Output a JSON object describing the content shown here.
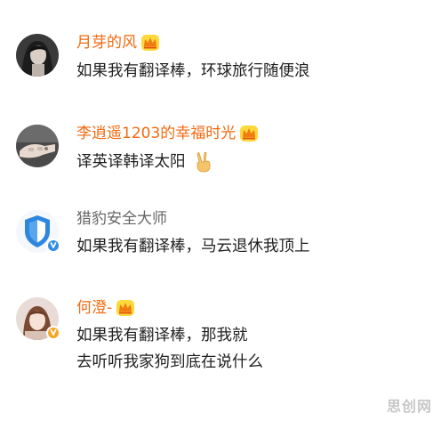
{
  "comments": [
    {
      "username": "月芽的风",
      "avatar": "avatar-photo-woman",
      "badge": "crown-icon",
      "lines": [
        "如果我有翻译棒，环球旅行随便浪"
      ]
    },
    {
      "username": "李逍遥1203的幸福时光",
      "avatar": "avatar-photo-hand",
      "badge": "crown-icon",
      "lines": [
        "译英译韩译太阳"
      ],
      "emoji": "victory-hand-emoji"
    },
    {
      "username": "猎豹安全大师",
      "avatar": "avatar-shield-logo",
      "verified": "blue-verified-icon",
      "lines": [
        "如果我有翻译棒，马云退休我顶上"
      ]
    },
    {
      "username": "何澄-",
      "avatar": "avatar-photo-girl",
      "badge": "crown-icon",
      "verified": "orange-verified-icon",
      "lines": [
        "如果我有翻译棒，那我就",
        "去听听我家狗到底在说什么"
      ]
    }
  ],
  "watermark": "思创网",
  "colors": {
    "vip_name": "#f26a10",
    "normal_name": "#666666",
    "text": "#1f1f1f",
    "verified_blue": "#2f8de4",
    "verified_orange": "#f6a623"
  }
}
